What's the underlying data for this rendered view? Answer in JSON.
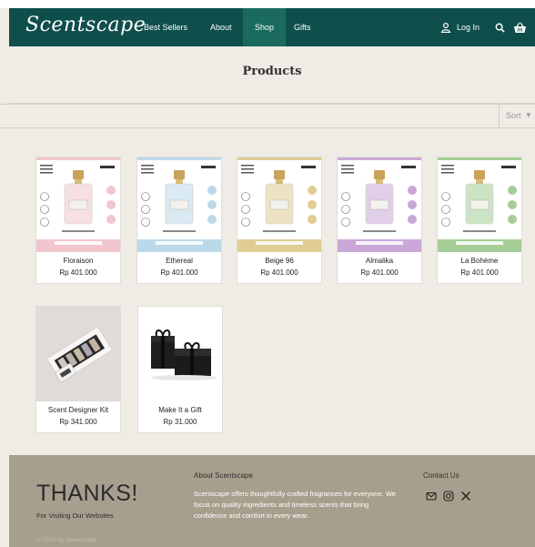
{
  "nav": {
    "logo": "Scentscape",
    "items": [
      {
        "label": "Best Sellers"
      },
      {
        "label": "About"
      },
      {
        "label": "Shop"
      },
      {
        "label": "Gifts"
      }
    ],
    "login_label": "Log In",
    "icons": [
      "user-icon",
      "search-icon",
      "basket-icon"
    ]
  },
  "page": {
    "title": "Products",
    "sort_label": "Sort"
  },
  "products": [
    {
      "name": "Floraison",
      "price": "Rp 401.000",
      "accent": "#f2c6cf"
    },
    {
      "name": "Ethereal",
      "price": "Rp 401.000",
      "accent": "#bcd9ea"
    },
    {
      "name": "Beige 96",
      "price": "Rp 401.000",
      "accent": "#dfcd93"
    },
    {
      "name": "Almalika",
      "price": "Rp 401.000",
      "accent": "#c9a7d8"
    },
    {
      "name": "La Bohème",
      "price": "Rp 401.000",
      "accent": "#a6cd97"
    },
    {
      "name": "Scent Designer Kit",
      "price": "Rp 341.000"
    },
    {
      "name": "Make It a Gift",
      "price": "Rp 31.000"
    }
  ],
  "footer": {
    "thanks": "THANKS!",
    "thanks_sub": "For Visiting Our Websites",
    "copyright": "© 2025 By Scentscape",
    "about_title": "About Scentscape",
    "about_text": "Scentscape offers thoughtfully crafted fragrances for everyone. We focus on quality ingredients and timeless scents that bring confidence and comfort in every wear.",
    "contact_title": "Contact Us",
    "contact_icons": [
      "mail-icon",
      "instagram-icon",
      "x-icon"
    ]
  },
  "colors": {
    "nav_bg": "#0e4f4b",
    "nav_active": "#1a6a60",
    "page_bg": "#efebe5",
    "footer_bg": "#a79f8d"
  }
}
